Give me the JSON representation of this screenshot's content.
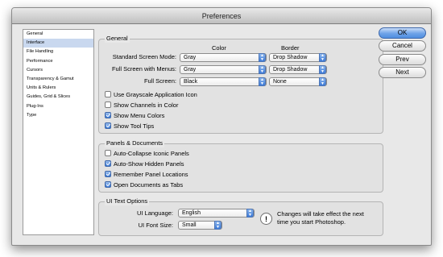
{
  "window": {
    "title": "Preferences"
  },
  "sidebar": {
    "items": [
      {
        "label": "General"
      },
      {
        "label": "Interface"
      },
      {
        "label": "File Handling"
      },
      {
        "label": "Performance"
      },
      {
        "label": "Cursors"
      },
      {
        "label": "Transparency & Gamut"
      },
      {
        "label": "Units & Rulers"
      },
      {
        "label": "Guides, Grid & Slices"
      },
      {
        "label": "Plug-Ins"
      },
      {
        "label": "Type"
      }
    ],
    "selected": "Interface"
  },
  "general": {
    "title": "General",
    "col_color": "Color",
    "col_border": "Border",
    "rows": [
      {
        "label": "Standard Screen Mode:",
        "color": "Gray",
        "border": "Drop Shadow"
      },
      {
        "label": "Full Screen with Menus:",
        "color": "Gray",
        "border": "Drop Shadow"
      },
      {
        "label": "Full Screen:",
        "color": "Black",
        "border": "None"
      }
    ],
    "checkboxes": [
      {
        "label": "Use Grayscale Application Icon",
        "checked": false
      },
      {
        "label": "Show Channels in Color",
        "checked": false
      },
      {
        "label": "Show Menu Colors",
        "checked": true
      },
      {
        "label": "Show Tool Tips",
        "checked": true
      }
    ]
  },
  "panels": {
    "title": "Panels & Documents",
    "checkboxes": [
      {
        "label": "Auto-Collapse Iconic Panels",
        "checked": false
      },
      {
        "label": "Auto-Show Hidden Panels",
        "checked": true
      },
      {
        "label": "Remember Panel Locations",
        "checked": true
      },
      {
        "label": "Open Documents as Tabs",
        "checked": true
      }
    ]
  },
  "ui_text": {
    "title": "UI Text Options",
    "language_label": "UI Language:",
    "language_value": "English",
    "font_size_label": "UI Font Size:",
    "font_size_value": "Small",
    "note_line1": "Changes will take effect the next",
    "note_line2": "time you start Photoshop."
  },
  "buttons": {
    "ok": "OK",
    "cancel": "Cancel",
    "prev": "Prev",
    "next": "Next"
  },
  "icons": {
    "popup_arrows": "up-down-arrows-icon",
    "info": "exclamation-icon"
  },
  "colors": {
    "accent": "#4f8ee0",
    "sidebar_selection": "#c9d8ef"
  }
}
